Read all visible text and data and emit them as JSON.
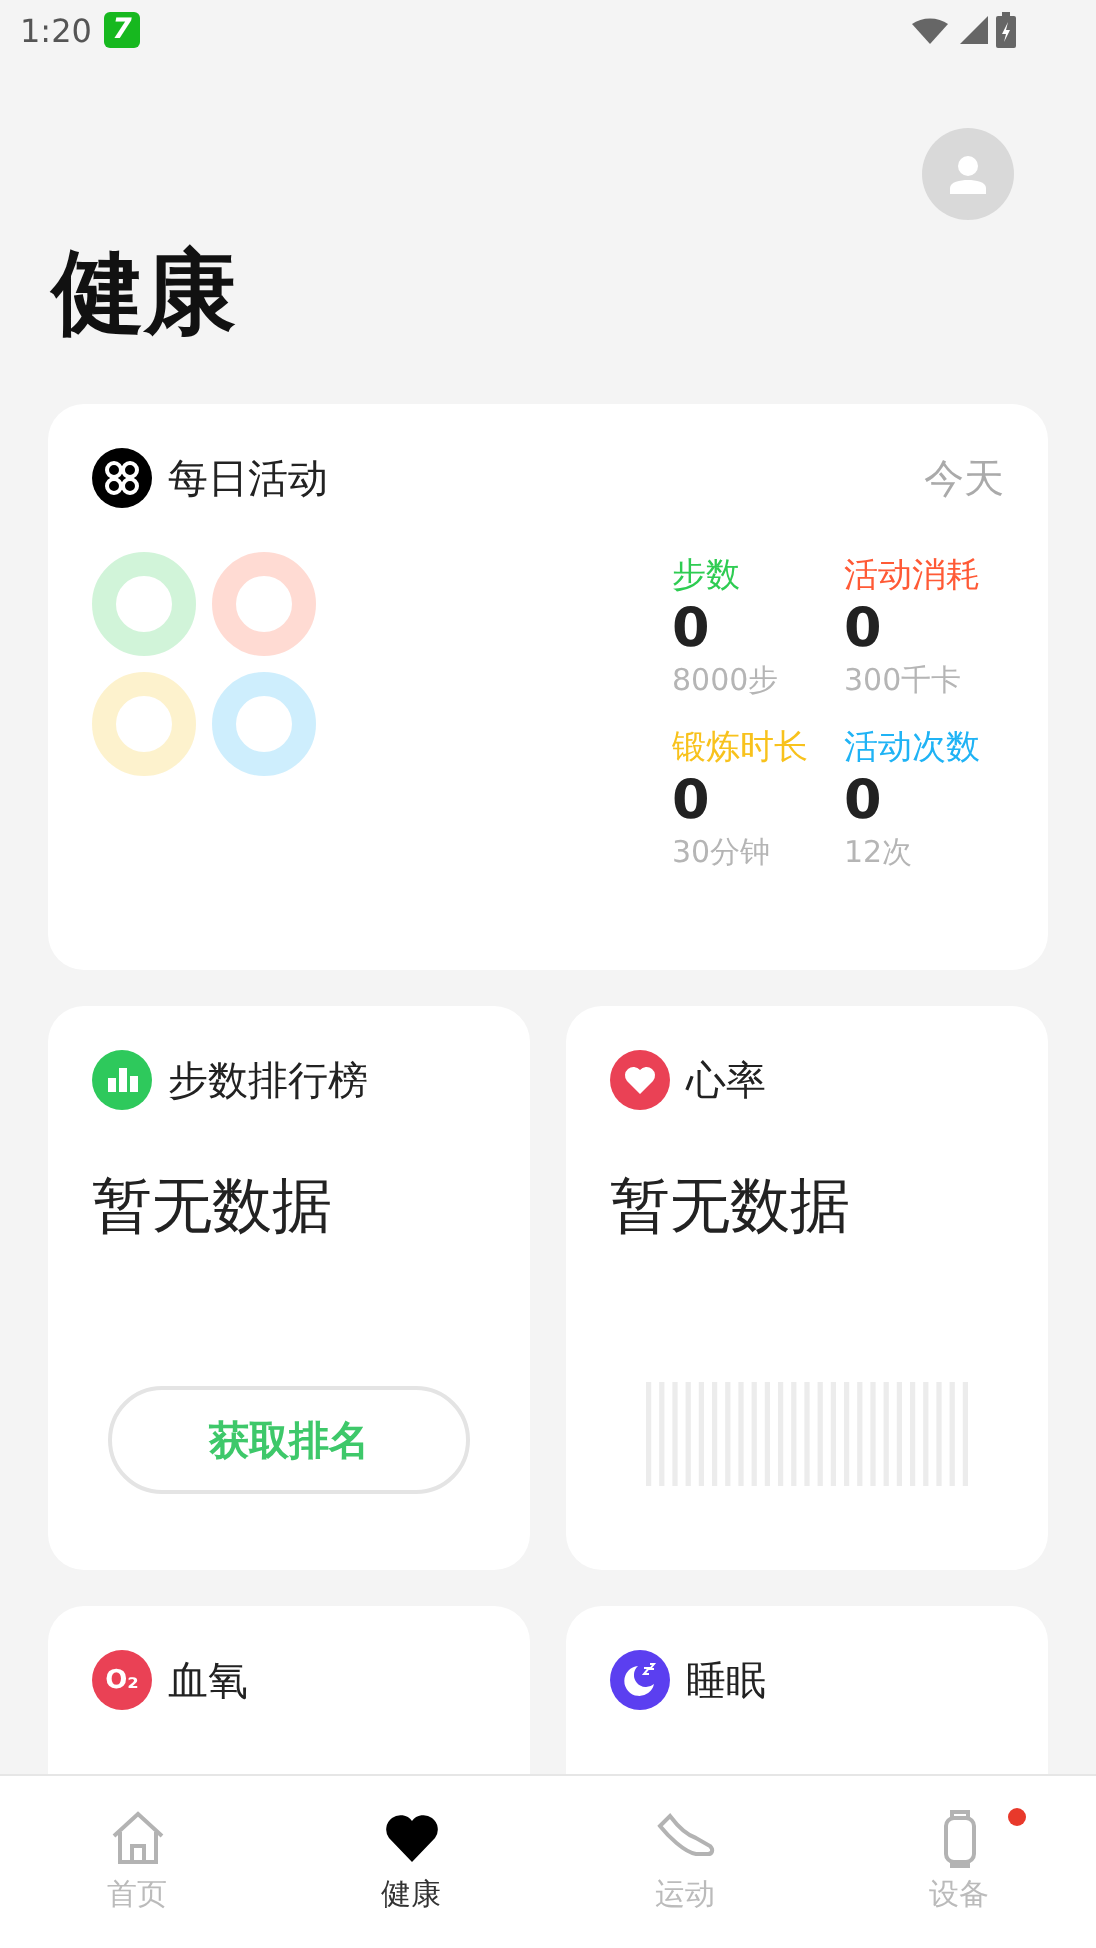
{
  "status_bar": {
    "time": "1:20",
    "notification_glyph": "7"
  },
  "title": "健康",
  "daily_activity": {
    "title": "每日活动",
    "period": "今天",
    "stats": [
      {
        "label": "步数",
        "color": "#2ecc52",
        "value": "0",
        "target": "8000步"
      },
      {
        "label": "活动消耗",
        "color": "#ff5a36",
        "value": "0",
        "target": "300千卡"
      },
      {
        "label": "锻炼时长",
        "color": "#f8c21c",
        "value": "0",
        "target": "30分钟"
      },
      {
        "label": "活动次数",
        "color": "#1fb3f5",
        "value": "0",
        "target": "12次"
      }
    ]
  },
  "cards": [
    {
      "kind": "ranking",
      "title": "步数排行榜",
      "message": "暂无数据",
      "button": "获取排名"
    },
    {
      "kind": "heart",
      "title": "心率",
      "message": "暂无数据"
    },
    {
      "kind": "oxygen",
      "title": "血氧",
      "icon_text": "O₂"
    },
    {
      "kind": "sleep",
      "title": "睡眠"
    }
  ],
  "nav": [
    {
      "kind": "home",
      "label": "首页",
      "selected": false,
      "badge": false
    },
    {
      "kind": "health",
      "label": "健康",
      "selected": true,
      "badge": false
    },
    {
      "kind": "sport",
      "label": "运动",
      "selected": false,
      "badge": false
    },
    {
      "kind": "device",
      "label": "设备",
      "selected": false,
      "badge": true
    }
  ]
}
